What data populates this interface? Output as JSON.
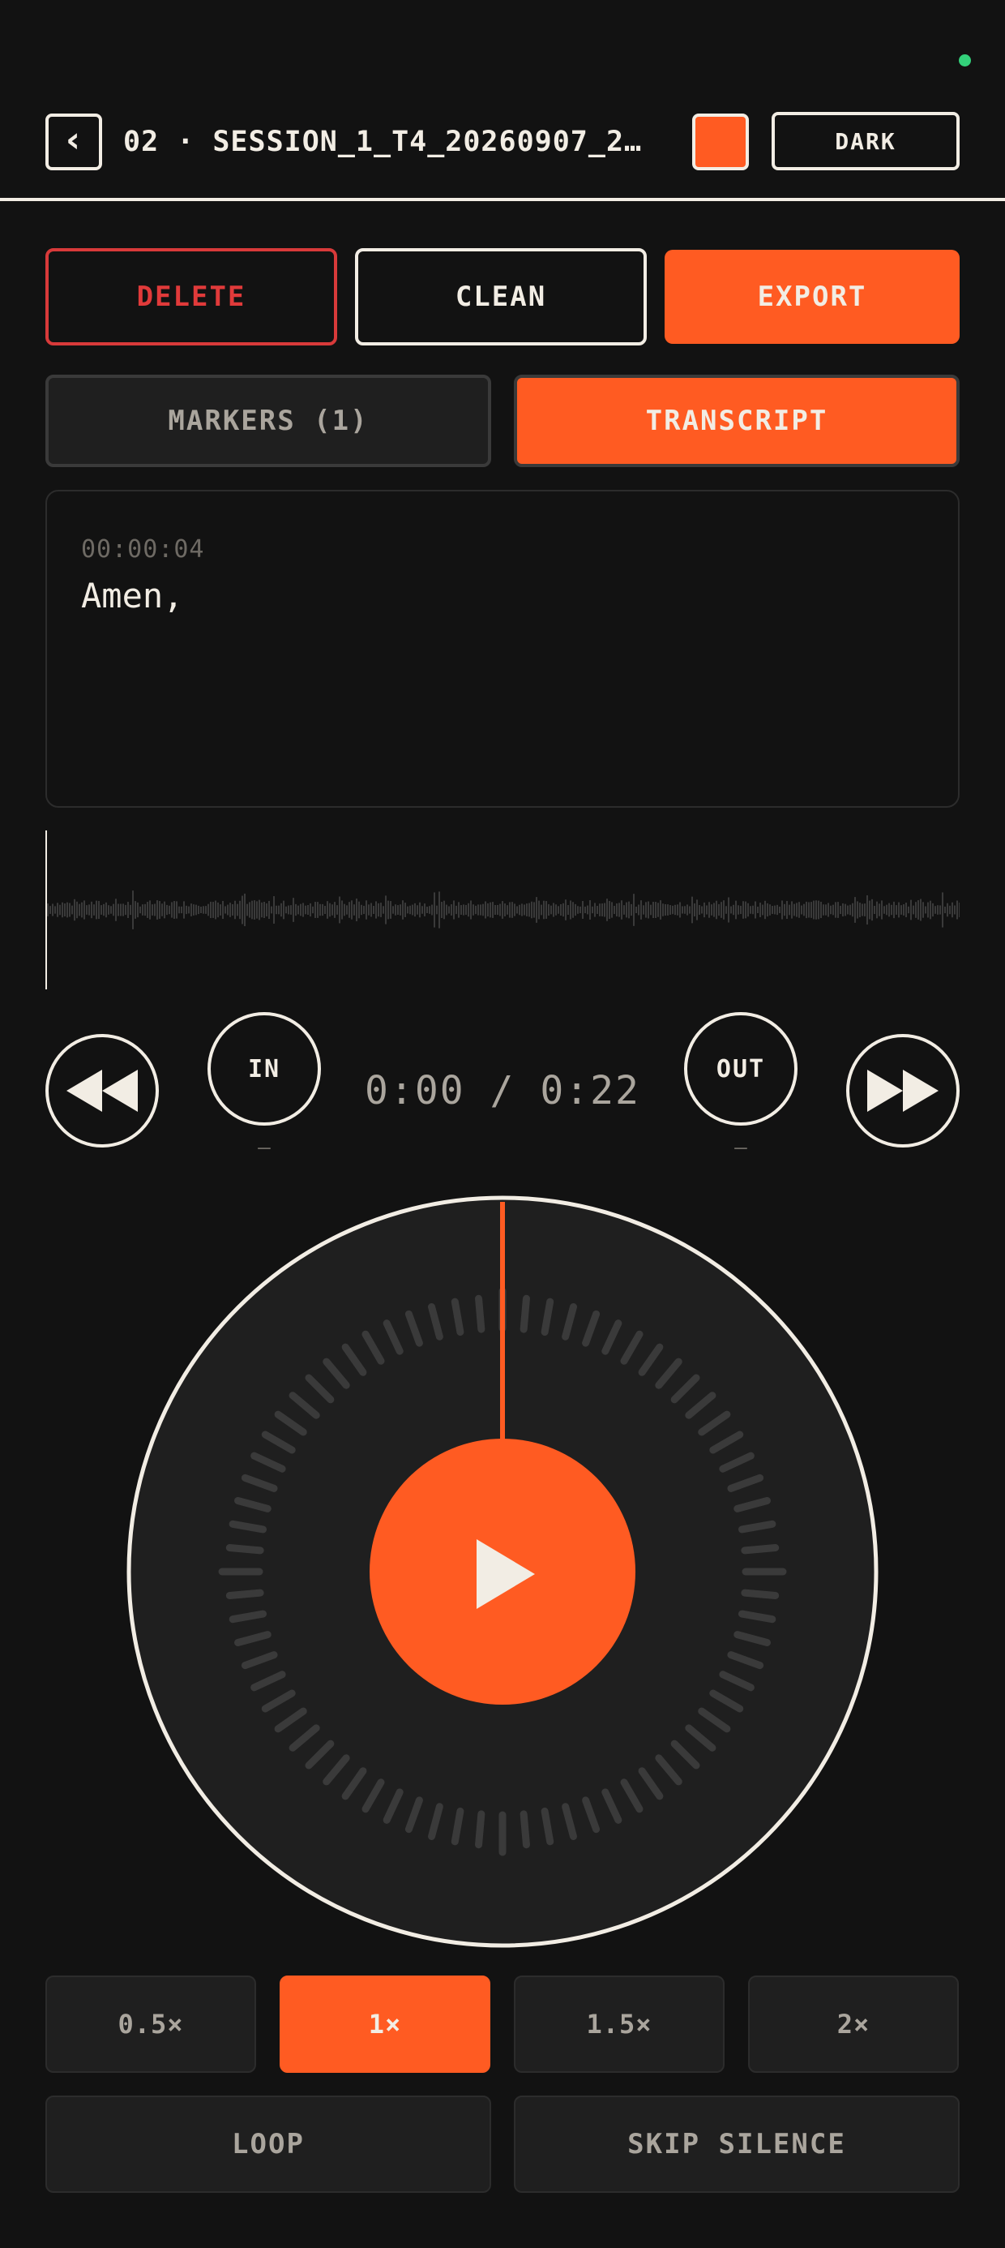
{
  "header": {
    "back_icon": "chevron-left-icon",
    "back_glyph": "‹",
    "title": "02 · SESSION_1_T4_20260907_2…",
    "theme_label": "DARK"
  },
  "actions": {
    "delete_label": "DELETE",
    "clean_label": "CLEAN",
    "export_label": "EXPORT"
  },
  "tabs": [
    {
      "label": "MARKERS (1)",
      "active": false
    },
    {
      "label": "TRANSCRIPT",
      "active": true
    }
  ],
  "transcript": {
    "timestamp": "00:00:04",
    "text": "Amen,"
  },
  "transport": {
    "rewind_icon": "rewind-icon",
    "forward_icon": "fast-forward-icon",
    "in_label": "IN",
    "in_value": "–",
    "out_label": "OUT",
    "out_value": "–",
    "time": "0:00 / 0:22",
    "progress": 0
  },
  "wheel": {
    "play_icon": "play-icon"
  },
  "speeds": [
    {
      "label": "0.5×",
      "active": false
    },
    {
      "label": "1×",
      "active": true
    },
    {
      "label": "1.5×",
      "active": false
    },
    {
      "label": "2×",
      "active": false
    }
  ],
  "options": {
    "loop_label": "LOOP",
    "skip_silence_label": "SKIP SILENCE"
  },
  "colors": {
    "accent": "#ff5b22",
    "background": "#121212",
    "surface": "#1f1f1f",
    "foreground": "#f2ede4",
    "danger": "#e03a3a",
    "status": "#33d17a"
  }
}
